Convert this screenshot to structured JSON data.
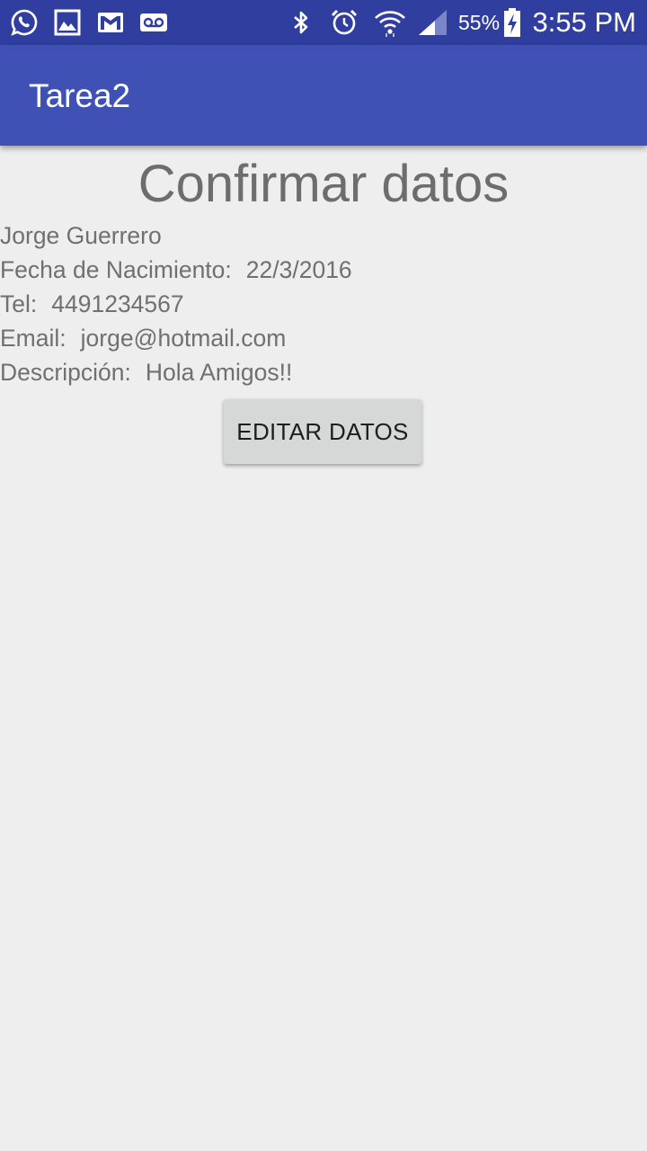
{
  "status_bar": {
    "battery": "55%",
    "time": "3:55 PM",
    "icons": [
      "whatsapp-icon",
      "gallery-icon",
      "gmail-icon",
      "voicemail-icon",
      "bluetooth-icon",
      "alarm-icon",
      "wifi-icon",
      "signal-icon",
      "battery-icon"
    ]
  },
  "app_bar": {
    "title": "Tarea2",
    "color": "#3f51b5"
  },
  "content": {
    "title": "Confirmar datos",
    "name": "Jorge Guerrero",
    "birth": {
      "label": "Fecha de Nacimiento:",
      "value": "22/3/2016"
    },
    "phone": {
      "label": "Tel:",
      "value": "4491234567"
    },
    "email": {
      "label": "Email:",
      "value": "jorge@hotmail.com"
    },
    "description": {
      "label": "Descripción:",
      "value": "Hola Amigos!!"
    },
    "edit_button_label": "EDITAR DATOS"
  },
  "colors": {
    "status_bar": "#303f9f",
    "primary": "#3f51b5",
    "background": "#eeeeee"
  }
}
